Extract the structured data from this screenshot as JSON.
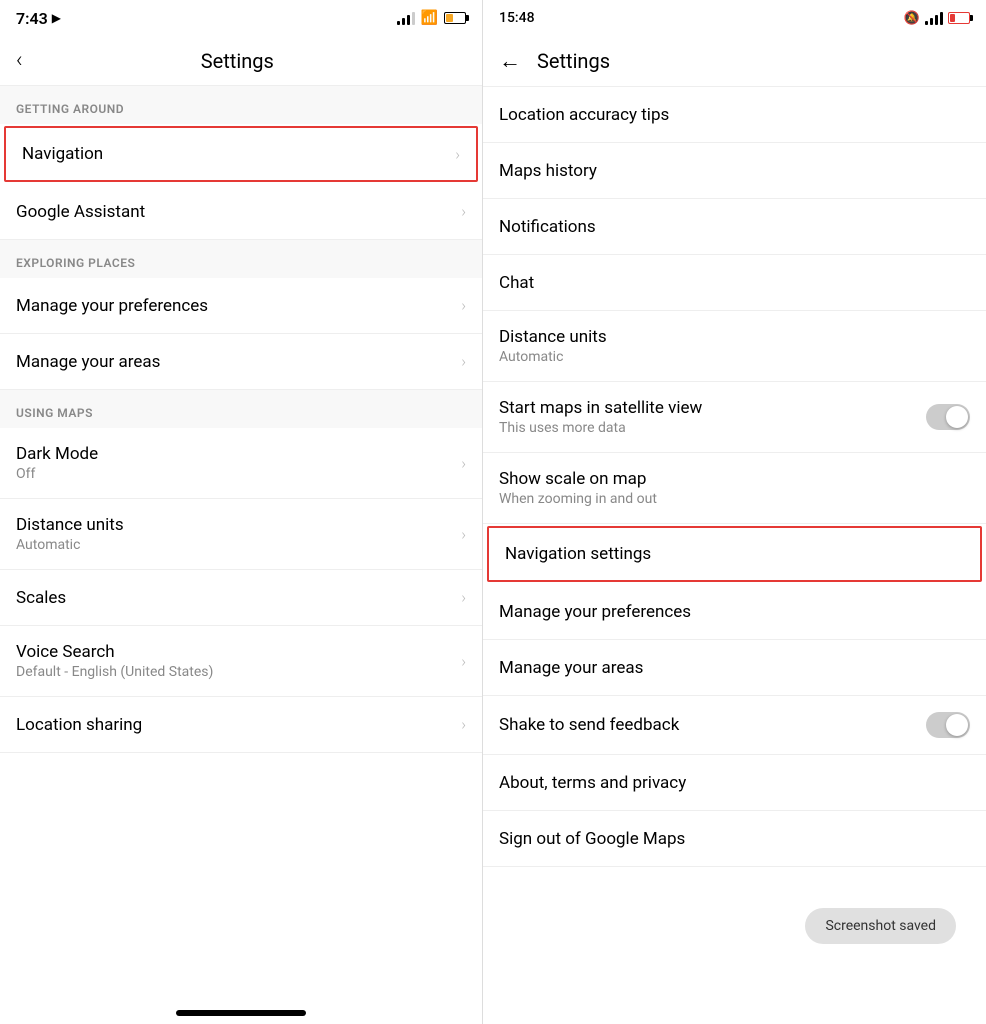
{
  "left": {
    "statusBar": {
      "time": "7:43",
      "locationArrow": "▶"
    },
    "header": {
      "back": "‹",
      "title": "Settings"
    },
    "sections": [
      {
        "id": "getting-around",
        "label": "GETTING AROUND",
        "items": [
          {
            "id": "navigation",
            "label": "Navigation",
            "sublabel": "",
            "hasChevron": true,
            "highlighted": true
          },
          {
            "id": "google-assistant",
            "label": "Google Assistant",
            "sublabel": "",
            "hasChevron": true,
            "highlighted": false
          }
        ]
      },
      {
        "id": "exploring-places",
        "label": "EXPLORING PLACES",
        "items": [
          {
            "id": "manage-preferences",
            "label": "Manage your preferences",
            "sublabel": "",
            "hasChevron": true,
            "highlighted": false
          },
          {
            "id": "manage-areas",
            "label": "Manage your areas",
            "sublabel": "",
            "hasChevron": true,
            "highlighted": false
          }
        ]
      },
      {
        "id": "using-maps",
        "label": "USING MAPS",
        "items": [
          {
            "id": "dark-mode",
            "label": "Dark Mode",
            "sublabel": "Off",
            "hasChevron": true,
            "highlighted": false
          },
          {
            "id": "distance-units",
            "label": "Distance units",
            "sublabel": "Automatic",
            "hasChevron": true,
            "highlighted": false
          },
          {
            "id": "scales",
            "label": "Scales",
            "sublabel": "",
            "hasChevron": true,
            "highlighted": false
          },
          {
            "id": "voice-search",
            "label": "Voice Search",
            "sublabel": "Default - English (United States)",
            "hasChevron": true,
            "highlighted": false
          },
          {
            "id": "location-sharing",
            "label": "Location sharing",
            "sublabel": "",
            "hasChevron": true,
            "highlighted": false
          }
        ]
      }
    ],
    "bottomIndicator": true
  },
  "right": {
    "statusBar": {
      "time": "15:48"
    },
    "header": {
      "back": "←",
      "title": "Settings"
    },
    "items": [
      {
        "id": "location-accuracy-tips",
        "label": "Location accuracy tips",
        "sublabel": "",
        "hasChevron": false,
        "hasToggle": false,
        "highlighted": false
      },
      {
        "id": "maps-history",
        "label": "Maps history",
        "sublabel": "",
        "hasChevron": false,
        "hasToggle": false,
        "highlighted": false
      },
      {
        "id": "notifications",
        "label": "Notifications",
        "sublabel": "",
        "hasChevron": false,
        "hasToggle": false,
        "highlighted": false
      },
      {
        "id": "chat",
        "label": "Chat",
        "sublabel": "",
        "hasChevron": false,
        "hasToggle": false,
        "highlighted": false
      },
      {
        "id": "distance-units-right",
        "label": "Distance units",
        "sublabel": "Automatic",
        "hasChevron": false,
        "hasToggle": false,
        "highlighted": false
      },
      {
        "id": "start-maps-satellite",
        "label": "Start maps in satellite view",
        "sublabel": "This uses more data",
        "hasChevron": false,
        "hasToggle": true,
        "highlighted": false
      },
      {
        "id": "show-scale-on-map",
        "label": "Show scale on map",
        "sublabel": "When zooming in and out",
        "hasChevron": false,
        "hasToggle": false,
        "highlighted": false
      },
      {
        "id": "navigation-settings",
        "label": "Navigation settings",
        "sublabel": "",
        "hasChevron": false,
        "hasToggle": false,
        "highlighted": true
      },
      {
        "id": "manage-preferences-right",
        "label": "Manage your preferences",
        "sublabel": "",
        "hasChevron": false,
        "hasToggle": false,
        "highlighted": false
      },
      {
        "id": "manage-areas-right",
        "label": "Manage your areas",
        "sublabel": "",
        "hasChevron": false,
        "hasToggle": false,
        "highlighted": false
      },
      {
        "id": "shake-feedback",
        "label": "Shake to send feedback",
        "sublabel": "",
        "hasChevron": false,
        "hasToggle": true,
        "highlighted": false
      },
      {
        "id": "about-terms",
        "label": "About, terms and privacy",
        "sublabel": "",
        "hasChevron": false,
        "hasToggle": false,
        "highlighted": false
      },
      {
        "id": "sign-out",
        "label": "Sign out of Google Maps",
        "sublabel": "",
        "hasChevron": false,
        "hasToggle": false,
        "highlighted": false
      }
    ],
    "toast": "Screenshot saved"
  },
  "icons": {
    "chevron": "›",
    "back": "‹",
    "backArrow": "←"
  }
}
